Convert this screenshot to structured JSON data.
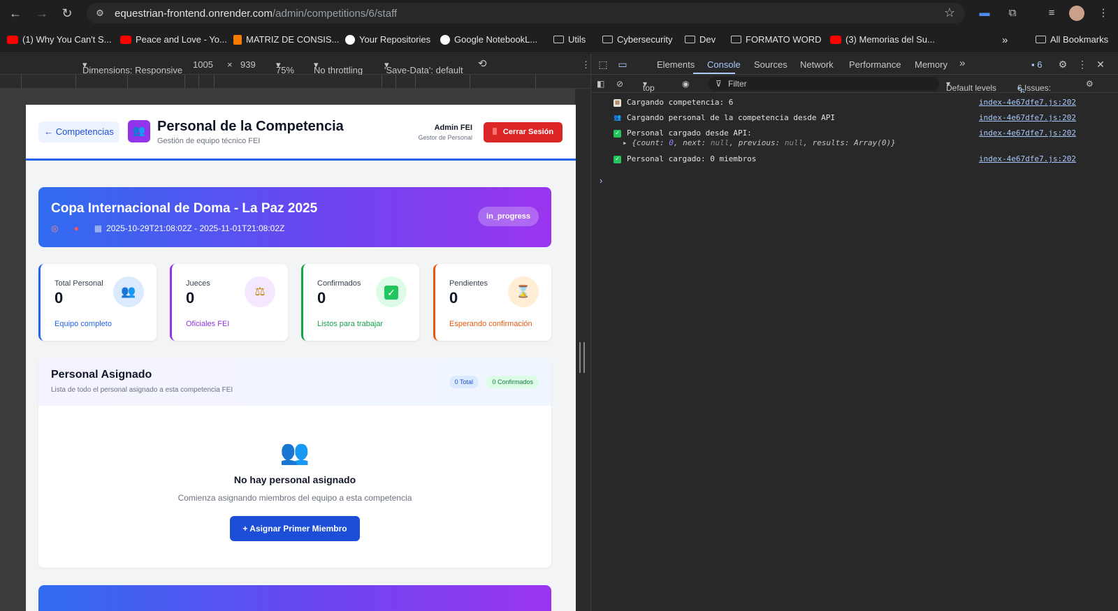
{
  "browser": {
    "url_host": "equestrian-frontend.onrender.com",
    "url_path": "/admin/competitions/6/staff",
    "bookmarks": [
      {
        "label": "(1) Why You Can't S...",
        "icon": "youtube-icon"
      },
      {
        "label": "Peace and Love - Yo...",
        "icon": "youtube-icon"
      },
      {
        "label": "MATRIZ DE CONSIS...",
        "icon": "matriz-icon"
      },
      {
        "label": "Your Repositories",
        "icon": "github-icon"
      },
      {
        "label": "Google NotebookL...",
        "icon": "notebooklm-icon"
      },
      {
        "label": "Utils",
        "icon": "folder-icon"
      },
      {
        "label": "Cybersecurity",
        "icon": "folder-icon"
      },
      {
        "label": "Dev",
        "icon": "folder-icon"
      },
      {
        "label": "FORMATO WORD",
        "icon": "folder-icon"
      },
      {
        "label": "(3) Memorias del Su...",
        "icon": "youtube-icon"
      }
    ],
    "all_bookmarks": "All Bookmarks"
  },
  "device_toolbar": {
    "dimensions": "Dimensions: Responsive",
    "width": "1005",
    "times": "×",
    "height": "939",
    "zoom": "75%",
    "throttling": "No throttling",
    "save_data": "'Save-Data': default"
  },
  "app": {
    "back_label": "← Competencias",
    "title": "Personal de la Competencia",
    "subtitle": "Gestión de equipo técnico FEI",
    "user_name": "Admin FEI",
    "user_role": "Gestor de Personal",
    "logout_label": "Cerrar Sesión",
    "competition": {
      "name": "Copa Internacional de Doma - La Paz 2025",
      "dates": "2025-10-29T21:08:02Z - 2025-11-01T21:08:02Z",
      "status": "in_progress"
    },
    "stats": [
      {
        "label": "Total Personal",
        "value": "0",
        "footer": "Equipo completo",
        "icon": "people-icon",
        "color": "#2563eb"
      },
      {
        "label": "Jueces",
        "value": "0",
        "footer": "Oficiales FEI",
        "icon": "scales-icon",
        "color": "#9333ea"
      },
      {
        "label": "Confirmados",
        "value": "0",
        "footer": "Listos para trabajar",
        "icon": "check-icon",
        "color": "#16a34a"
      },
      {
        "label": "Pendientes",
        "value": "0",
        "footer": "Esperando confirmación",
        "icon": "hourglass-icon",
        "color": "#ea580c"
      }
    ],
    "panel": {
      "title": "Personal Asignado",
      "subtitle": "Lista de todo el personal asignado a esta competencia FEI",
      "total_pill": "0 Total",
      "confirmed_pill": "0 Confirmados",
      "empty_title": "No hay personal asignado",
      "empty_subtitle": "Comienza asignando miembros del equipo a esta competencia",
      "assign_label": "+ Asignar Primer Miembro"
    }
  },
  "devtools": {
    "tabs": [
      "Elements",
      "Console",
      "Sources",
      "Network",
      "Performance",
      "Memory"
    ],
    "active_tab": "Console",
    "message_count": "6",
    "context": "top",
    "filter_placeholder": "Filter",
    "levels": "Default levels",
    "issues_label": "6 Issues:",
    "issues_count": "6",
    "logs": [
      {
        "text": "Cargando competencia: 6",
        "source": "index-4e67dfe7.js:202",
        "icon": "clipboard-icon"
      },
      {
        "text": "Cargando personal de la competencia desde API",
        "source": "index-4e67dfe7.js:202",
        "icon": "people-icon"
      },
      {
        "text": "Personal cargado desde API:",
        "source": "index-4e67dfe7.js:202",
        "icon": "check-icon"
      },
      {
        "text": "Personal cargado: 0 miembros",
        "source": "index-4e67dfe7.js:202",
        "icon": "check-icon"
      }
    ]
  }
}
